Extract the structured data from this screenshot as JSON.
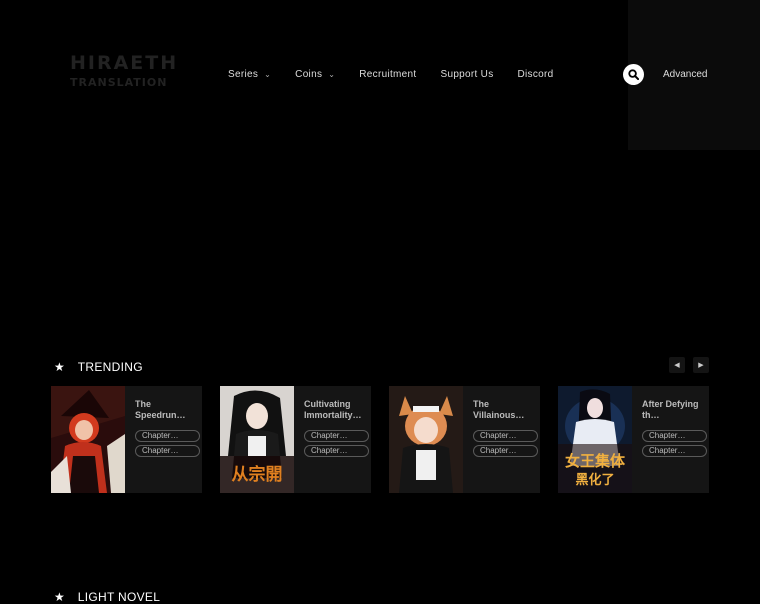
{
  "header": {
    "logo_line1": "HIRAETH",
    "logo_line2": "TRANSLATION",
    "nav": [
      {
        "label": "Series",
        "dropdown": true
      },
      {
        "label": "Coins",
        "dropdown": true
      },
      {
        "label": "Recruitment",
        "dropdown": false
      },
      {
        "label": "Support Us",
        "dropdown": false
      },
      {
        "label": "Discord",
        "dropdown": false
      }
    ],
    "caret": "⌄",
    "search_icon": "search-icon",
    "advanced_label": "Advanced"
  },
  "trending": {
    "title": "TRENDING",
    "star": "★",
    "prev": "◀",
    "next": "▶",
    "cards": [
      {
        "title": "The Speedrun…",
        "chapters": [
          "Chapter…",
          "Chapter…"
        ],
        "cover": "red-hair-witch-cover"
      },
      {
        "title": "Cultivating Immortality…",
        "chapters": [
          "Chapter…",
          "Chapter…"
        ],
        "cover": "dark-hair-swordswoman-cover"
      },
      {
        "title": "The Villainous…",
        "chapters": [
          "Chapter…",
          "Chapter…"
        ],
        "cover": "fox-ear-maid-cover"
      },
      {
        "title": "After Defying th…",
        "chapters": [
          "Chapter…",
          "Chapter…"
        ],
        "cover": "white-robed-empress-cover"
      }
    ]
  },
  "light_novel": {
    "title": "LIGHT NOVEL",
    "star": "★"
  },
  "colors": {
    "background": "#000000",
    "card": "#151515",
    "accent": "#ffffff"
  }
}
